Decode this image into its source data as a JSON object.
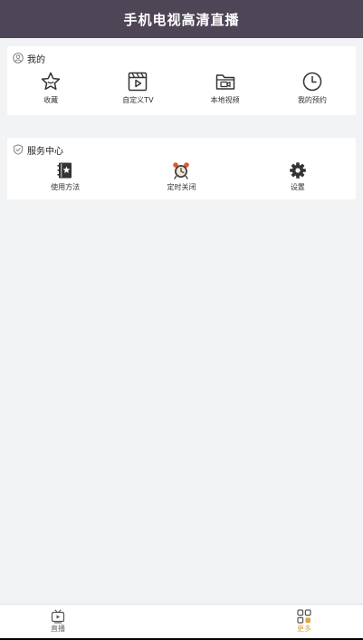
{
  "header": {
    "title": "手机电视高清直播"
  },
  "mine": {
    "title": "我的",
    "items": [
      {
        "label": "收藏",
        "icon": "star-icon"
      },
      {
        "label": "自定义TV",
        "icon": "video-player-icon"
      },
      {
        "label": "本地视频",
        "icon": "video-folder-icon"
      },
      {
        "label": "我的预约",
        "icon": "clock-icon"
      }
    ]
  },
  "service": {
    "title": "服务中心",
    "items": [
      {
        "label": "使用方法",
        "icon": "guide-book-icon"
      },
      {
        "label": "定时关闭",
        "icon": "alarm-clock-icon"
      },
      {
        "label": "设置",
        "icon": "gear-icon"
      }
    ]
  },
  "tabbar": {
    "tabs": [
      {
        "label": "直播",
        "icon": "tv-icon",
        "active": false
      },
      {
        "label": "更多",
        "icon": "grid-icon",
        "active": true
      }
    ]
  },
  "colors": {
    "header_bg": "#4e4656",
    "page_bg": "#f2f3f5",
    "active_tab": "#d9a74a",
    "alarm_accent": "#e05a2b"
  }
}
